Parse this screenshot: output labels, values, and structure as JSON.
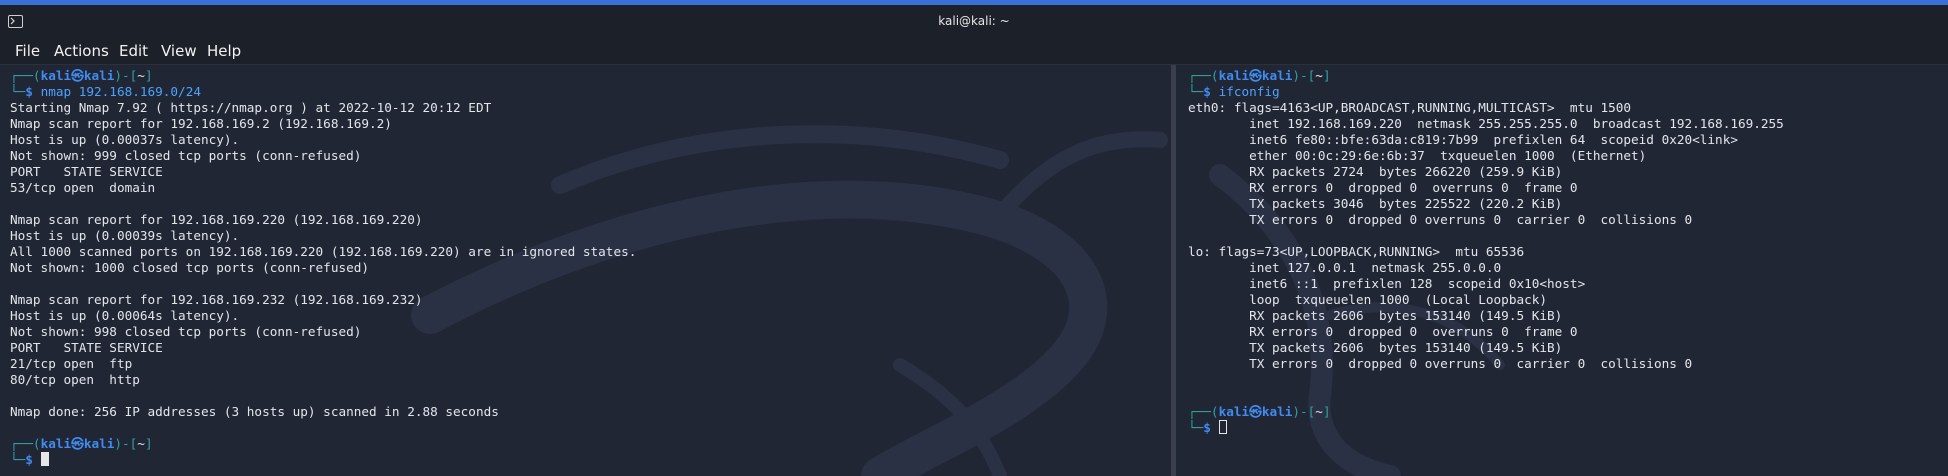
{
  "window": {
    "title": "kali@kali: ~",
    "icon": "terminal-icon"
  },
  "menu": {
    "file": "File",
    "actions": "Actions",
    "edit": "Edit",
    "view": "View",
    "help": "Help"
  },
  "prompt": {
    "open": "┌──(",
    "user": "kali",
    "at": "㉿",
    "host": "kali",
    "close": ")-[",
    "path": "~",
    "end": "]",
    "corner": "└─",
    "dollar": "$ "
  },
  "left_pane": {
    "command": "nmap 192.168.169.0/24",
    "output": [
      "Starting Nmap 7.92 ( https://nmap.org ) at 2022-10-12 20:12 EDT",
      "Nmap scan report for 192.168.169.2 (192.168.169.2)",
      "Host is up (0.00037s latency).",
      "Not shown: 999 closed tcp ports (conn-refused)",
      "PORT   STATE SERVICE",
      "53/tcp open  domain",
      "",
      "Nmap scan report for 192.168.169.220 (192.168.169.220)",
      "Host is up (0.00039s latency).",
      "All 1000 scanned ports on 192.168.169.220 (192.168.169.220) are in ignored states.",
      "Not shown: 1000 closed tcp ports (conn-refused)",
      "",
      "Nmap scan report for 192.168.169.232 (192.168.169.232)",
      "Host is up (0.00064s latency).",
      "Not shown: 998 closed tcp ports (conn-refused)",
      "PORT   STATE SERVICE",
      "21/tcp open  ftp",
      "80/tcp open  http",
      "",
      "Nmap done: 256 IP addresses (3 hosts up) scanned in 2.88 seconds",
      ""
    ]
  },
  "right_pane": {
    "command": "ifconfig",
    "output": [
      "eth0: flags=4163<UP,BROADCAST,RUNNING,MULTICAST>  mtu 1500",
      "        inet 192.168.169.220  netmask 255.255.255.0  broadcast 192.168.169.255",
      "        inet6 fe80::bfe:63da:c819:7b99  prefixlen 64  scopeid 0x20<link>",
      "        ether 00:0c:29:6e:6b:37  txqueuelen 1000  (Ethernet)",
      "        RX packets 2724  bytes 266220 (259.9 KiB)",
      "        RX errors 0  dropped 0  overruns 0  frame 0",
      "        TX packets 3046  bytes 225522 (220.2 KiB)",
      "        TX errors 0  dropped 0 overruns 0  carrier 0  collisions 0",
      "",
      "lo: flags=73<UP,LOOPBACK,RUNNING>  mtu 65536",
      "        inet 127.0.0.1  netmask 255.0.0.0",
      "        inet6 ::1  prefixlen 128  scopeid 0x10<host>",
      "        loop  txqueuelen 1000  (Local Loopback)",
      "        RX packets 2606  bytes 153140 (149.5 KiB)",
      "        RX errors 0  dropped 0  overruns 0  frame 0",
      "        TX packets 2606  bytes 153140 (149.5 KiB)",
      "        TX errors 0  dropped 0 overruns 0  carrier 0  collisions 0",
      "",
      ""
    ]
  },
  "colors": {
    "accent": "#3a6fd8",
    "background": "#212634",
    "prompt_user": "#3f8bf0",
    "prompt_frame": "#2aa3a3"
  }
}
